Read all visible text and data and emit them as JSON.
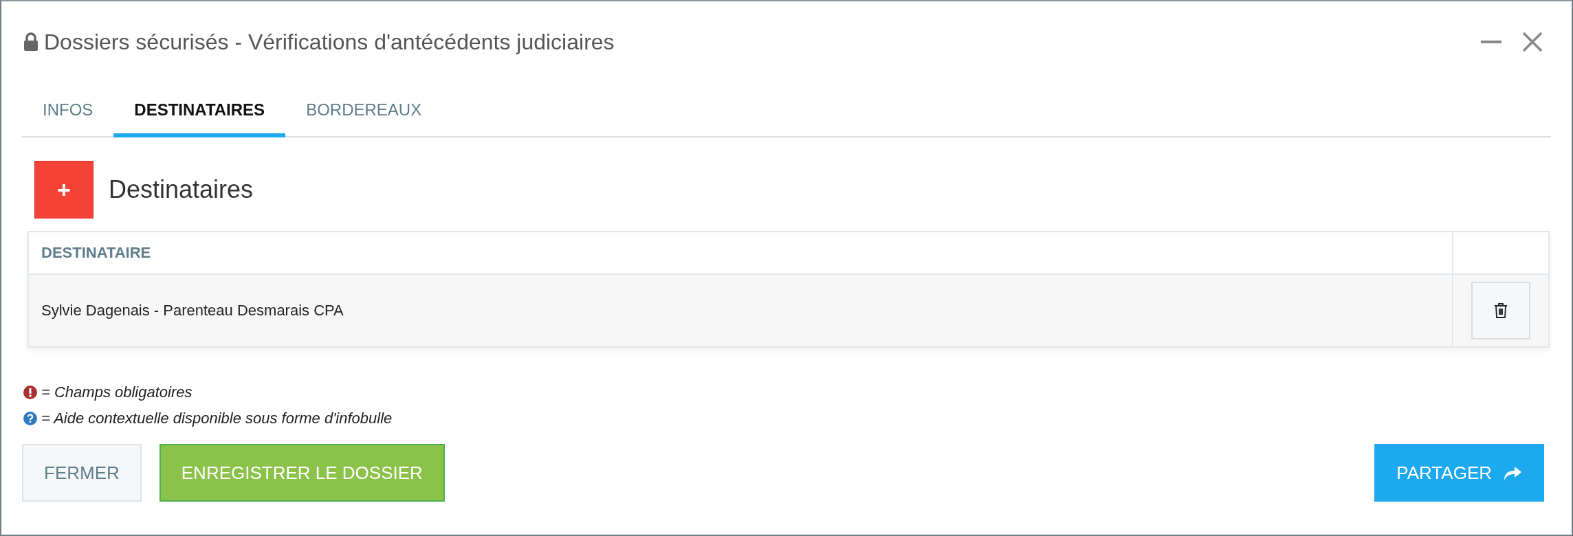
{
  "window": {
    "title": "Dossiers sécurisés - Vérifications d'antécédents judiciaires"
  },
  "tabs": [
    {
      "label": "INFOS",
      "selected": false
    },
    {
      "label": "DESTINATAIRES",
      "selected": true
    },
    {
      "label": "BORDEREAUX",
      "selected": false
    }
  ],
  "section": {
    "title": "Destinataires",
    "add_button": "+"
  },
  "table": {
    "columns": [
      "DESTINATAIRE"
    ],
    "rows": [
      {
        "cells": [
          "Sylvie Dagenais - Parenteau Desmarais CPA"
        ]
      }
    ]
  },
  "legend": [
    {
      "kind": "required",
      "text": "= Champs obligatoires"
    },
    {
      "kind": "help",
      "text": "= Aide contextuelle disponible sous forme d'infobulle"
    }
  ],
  "buttons": [
    {
      "kind": "secondary",
      "label": "FERMER"
    },
    {
      "kind": "success",
      "label": "ENREGISTRER LE DOSSIER"
    },
    {
      "kind": "primary",
      "label": "PARTAGER"
    }
  ]
}
